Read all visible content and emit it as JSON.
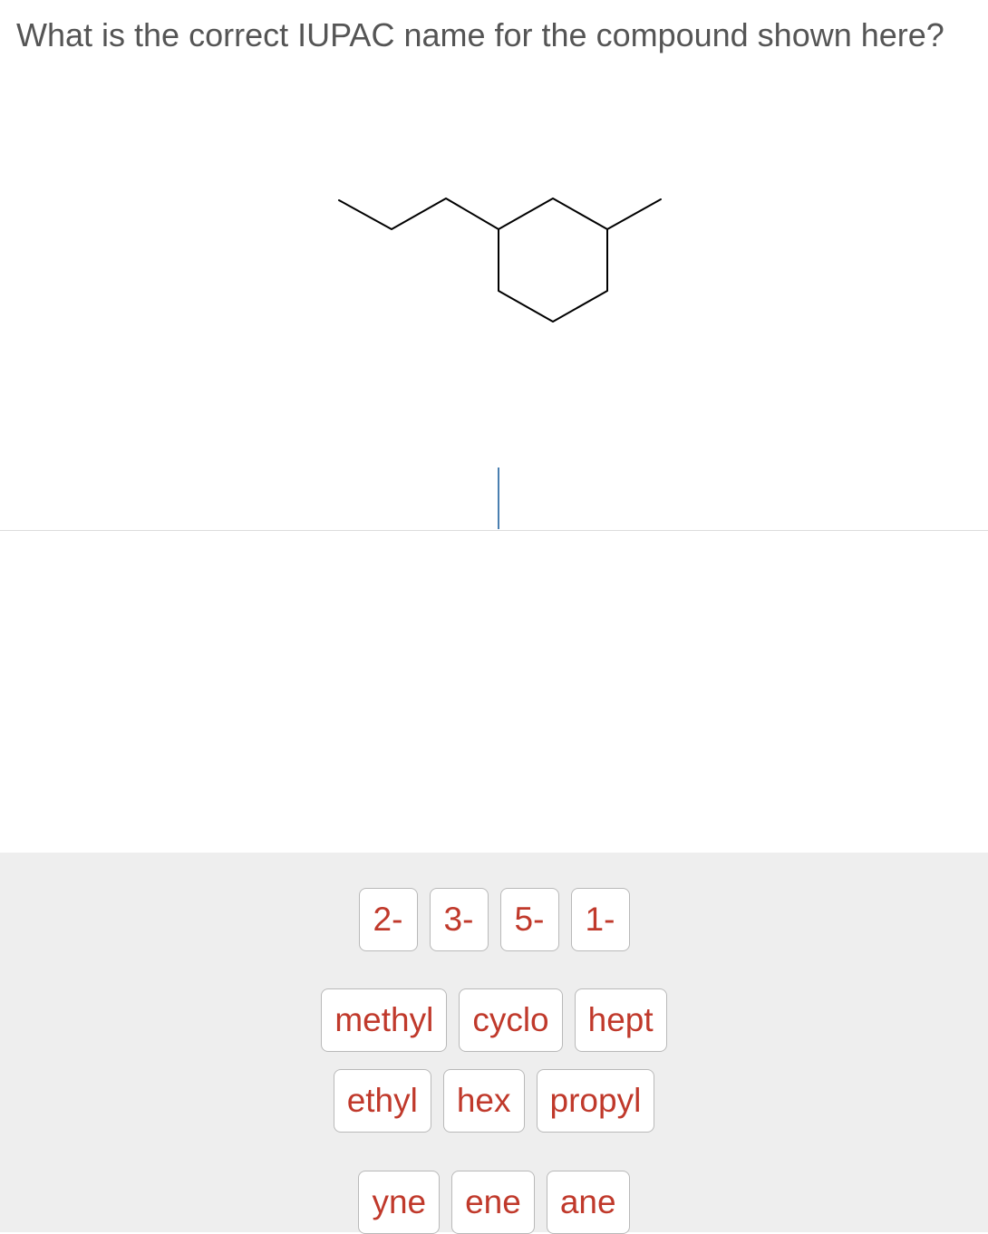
{
  "question": {
    "text": "What is the correct IUPAC name for the compound shown here?"
  },
  "structure": {
    "description_icon": "skeletal-structure"
  },
  "tray": {
    "locants": [
      "2-",
      "3-",
      "5-",
      "1-"
    ],
    "substituents": [
      "methyl",
      "cyclo",
      "hept"
    ],
    "parents": [
      "ethyl",
      "hex",
      "propyl"
    ],
    "suffixes": [
      "yne",
      "ene",
      "ane"
    ]
  },
  "colors": {
    "tile_text": "#c0392b",
    "tray_background": "#eeeeee",
    "cursor": "#4a7fb0"
  }
}
